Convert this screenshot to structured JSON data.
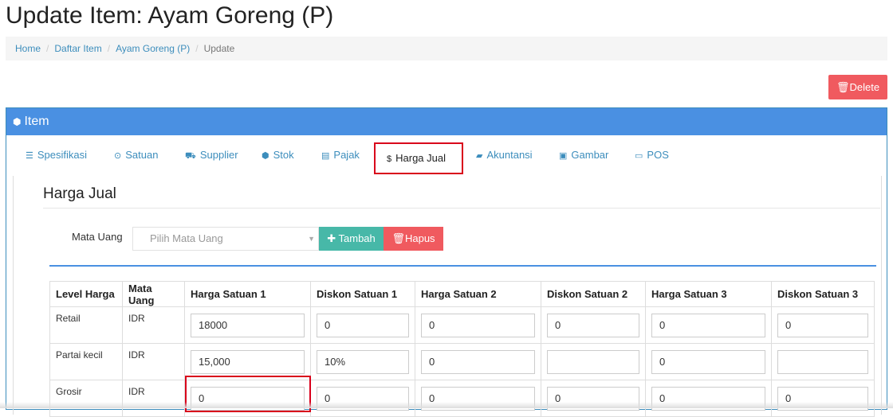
{
  "page": {
    "title": "Update Item: Ayam Goreng (P)"
  },
  "breadcrumb": [
    {
      "label": "Home"
    },
    {
      "label": "Daftar Item"
    },
    {
      "label": "Ayam Goreng (P)"
    },
    {
      "label": "Update"
    }
  ],
  "actions": {
    "delete_label": "Delete",
    "delete_icon": "trash-icon"
  },
  "panel": {
    "title": "Item",
    "icon": "cube-icon"
  },
  "tabs": [
    {
      "label": "Spesifikasi",
      "icon": "list-icon"
    },
    {
      "label": "Satuan",
      "icon": "check-circle-icon"
    },
    {
      "label": "Supplier",
      "icon": "truck-icon"
    },
    {
      "label": "Stok",
      "icon": "cube-icon"
    },
    {
      "label": "Pajak",
      "icon": "card-icon"
    },
    {
      "label": "Harga Jual",
      "icon": "dollar-icon"
    },
    {
      "label": "Akuntansi",
      "icon": "book-icon"
    },
    {
      "label": "Gambar",
      "icon": "image-icon"
    },
    {
      "label": "POS",
      "icon": "monitor-icon"
    }
  ],
  "section": {
    "title": "Harga Jual",
    "mata_uang_label": "Mata Uang",
    "mata_uang_placeholder": "Pilih Mata Uang",
    "tambah_label": "Tambah",
    "hapus_label": "Hapus"
  },
  "table": {
    "headers": [
      "Level Harga",
      "Mata Uang",
      "Harga Satuan 1",
      "Diskon Satuan 1",
      "Harga Satuan 2",
      "Diskon Satuan 2",
      "Harga Satuan 3",
      "Diskon Satuan 3"
    ],
    "rows": [
      {
        "level": "Retail",
        "currency": "IDR",
        "values": [
          "18000",
          "0",
          "0",
          "0",
          "0",
          "0"
        ]
      },
      {
        "level": "Partai kecil",
        "currency": "IDR",
        "values": [
          "15,000",
          "10%",
          "0",
          "",
          "0",
          ""
        ]
      },
      {
        "level": "Grosir",
        "currency": "IDR",
        "values": [
          "0",
          "0",
          "0",
          "0",
          "0",
          "0"
        ]
      }
    ]
  },
  "colors": {
    "primary": "#4a90e2",
    "danger": "#f05a5f",
    "success": "#47b8a8",
    "highlight": "#d9001b"
  }
}
